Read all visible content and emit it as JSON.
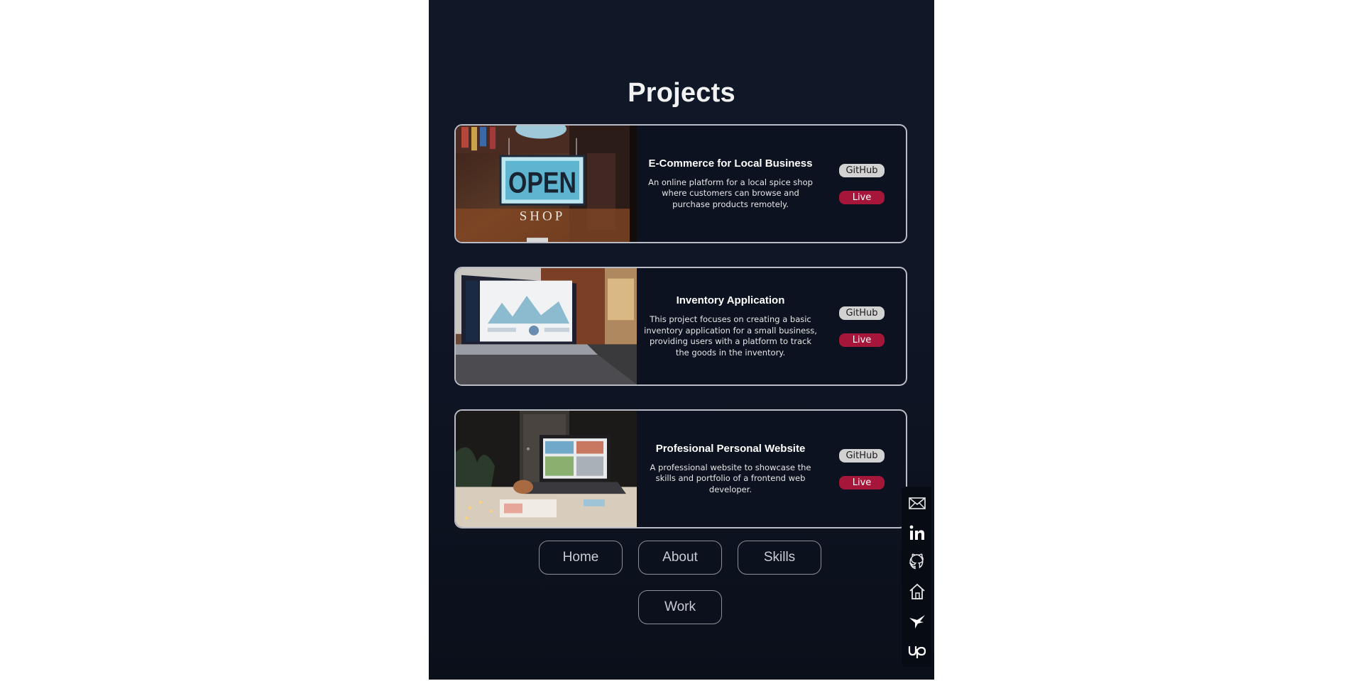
{
  "page_title": "Projects",
  "projects": [
    {
      "title": "E-Commerce for Local Business",
      "description": "An online platform for a local spice shop where customers can browse and purchase products remotely.",
      "image_sign": "OPEN",
      "image_sub": "SHOP",
      "github_label": "GitHub",
      "live_label": "Live"
    },
    {
      "title": "Inventory Application",
      "description": "This project focuses on creating a basic inventory application for a small business, providing users with a platform to track the goods in the inventory.",
      "github_label": "GitHub",
      "live_label": "Live"
    },
    {
      "title": "Profesional Personal Website",
      "description": "A professional website to showcase the skills and portfolio of a frontend web developer.",
      "github_label": "GitHub",
      "live_label": "Live"
    }
  ],
  "nav": [
    {
      "label": "Home"
    },
    {
      "label": "About"
    },
    {
      "label": "Skills"
    },
    {
      "label": "Work"
    }
  ],
  "social": [
    {
      "icon": "mail-icon"
    },
    {
      "icon": "linkedin-icon"
    },
    {
      "icon": "github-icon"
    },
    {
      "icon": "home-icon"
    },
    {
      "icon": "hummingbird-icon"
    },
    {
      "icon": "upwork-icon"
    }
  ],
  "colors": {
    "background": "#0f1626",
    "live": "#a6163a",
    "github": "#d2d2d2",
    "card_border": "#b9bcc4"
  }
}
